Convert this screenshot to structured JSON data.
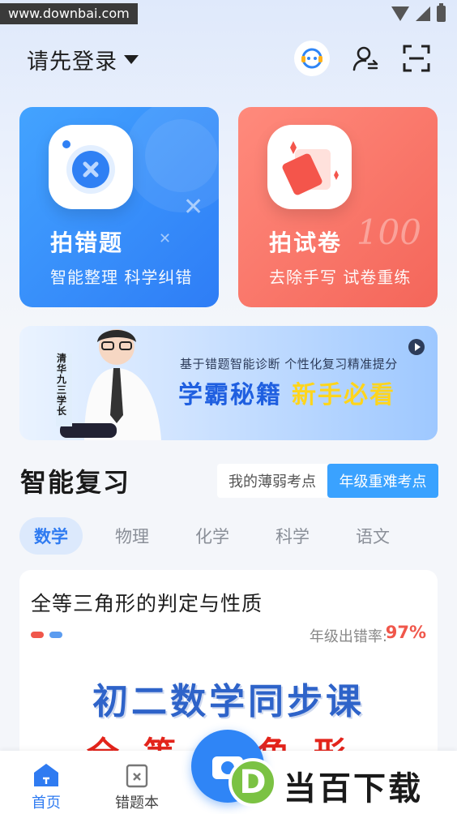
{
  "status_bar": {
    "watermark": "www.downbai.com"
  },
  "header": {
    "login_label": "请先登录",
    "icons": [
      "chat-bot-icon",
      "user-switch-icon",
      "scan-icon"
    ]
  },
  "cards": [
    {
      "title": "拍错题",
      "subtitle": "智能整理 科学纠错",
      "color": "#2f7df6"
    },
    {
      "title": "拍试卷",
      "subtitle": "去除手写 试卷重练",
      "color": "#f4665a",
      "decoration": "100"
    }
  ],
  "banner": {
    "subtitle": "基于错题智能诊断 个性化复习精准提分",
    "main_1": "学霸秘籍",
    "main_2": "新手必看",
    "person_tag": "清华九三学长"
  },
  "review": {
    "title": "智能复习",
    "segments": [
      "我的薄弱考点",
      "年级重难考点"
    ],
    "active_segment": "年级重难考点"
  },
  "subjects": {
    "items": [
      "数学",
      "物理",
      "化学",
      "科学",
      "语文"
    ],
    "active": "数学"
  },
  "topic": {
    "title": "全等三角形的判定与性质",
    "error_label": "年级出错率:",
    "error_rate": "97%",
    "course_title": "初二数学同步课",
    "course_sub": "全等三角形"
  },
  "bottom_nav": {
    "items": [
      "首页",
      "错题本"
    ],
    "active": "首页"
  },
  "brand": {
    "logo_letter": "D",
    "logo_text": "当百下载"
  },
  "colors": {
    "accent": "#2f7bf1",
    "error": "#f0574b",
    "card_red": "#f4665a"
  }
}
